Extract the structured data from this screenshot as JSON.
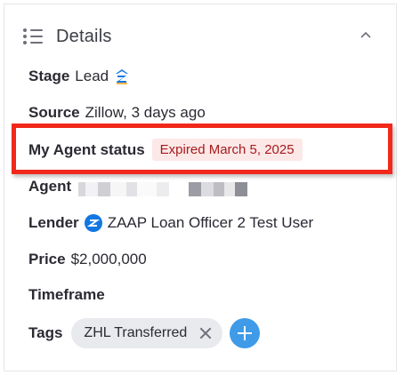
{
  "header": {
    "title": "Details",
    "icon": "list-icon",
    "collapse_icon": "chevron-up-icon"
  },
  "stage": {
    "label": "Stage",
    "value": "Lead",
    "icon": "zillow-logo-icon"
  },
  "source": {
    "label": "Source",
    "value": "Zillow, 3 days ago"
  },
  "agent_status": {
    "label": "My Agent status",
    "badge": "Expired March 5, 2025",
    "badge_bg": "#fde8e8",
    "badge_fg": "#a61b1b"
  },
  "agent": {
    "label": "Agent"
  },
  "lender": {
    "label": "Lender",
    "value": "ZAAP Loan Officer 2 Test User",
    "icon": "zillow-circle-icon"
  },
  "price": {
    "label": "Price",
    "value": "$2,000,000"
  },
  "timeframe": {
    "label": "Timeframe"
  },
  "tags": {
    "label": "Tags",
    "items": [
      {
        "label": "ZHL Transferred"
      }
    ],
    "add_icon": "plus-icon"
  },
  "colors": {
    "highlight": "#f1281c",
    "accent": "#3f9be8",
    "zillow_blue": "#1277e1"
  }
}
